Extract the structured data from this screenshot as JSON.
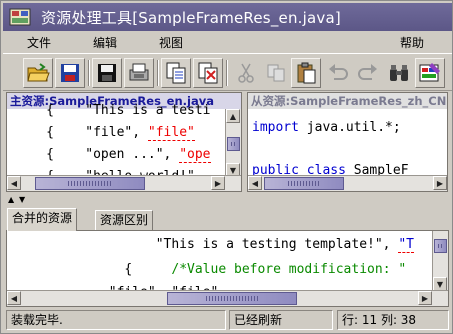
{
  "window": {
    "title": "资源处理工具[SampleFrameRes_en.java]"
  },
  "menu": {
    "file": "文件",
    "edit": "编辑",
    "view": "视图",
    "help": "帮助"
  },
  "toolbar": {
    "icons": [
      "open-folder-icon",
      "save-disk-icon",
      "save-all-icon",
      "print-icon",
      "copy-resource-icon",
      "delete-resource-icon",
      "cut-icon",
      "copy-icon",
      "paste-icon",
      "undo-icon",
      "redo-icon",
      "find-icon",
      "settings-icon"
    ]
  },
  "left_pane": {
    "header": "主资源:SampleFrameRes_en.java",
    "lines": [
      {
        "prefix": "     {    ",
        "text": "\"This is a testi",
        "link": ""
      },
      {
        "prefix": "     {    ",
        "text": "\"file\", ",
        "link": "\"file\""
      },
      {
        "prefix": "     {    ",
        "text": "\"open ...\", ",
        "link": "\"ope"
      },
      {
        "prefix": "     {    ",
        "text": "\"hello world!\"",
        "link": ""
      }
    ]
  },
  "right_pane": {
    "header": "从资源:SampleFrameRes_zh_CN.java",
    "line1_kw": "import",
    "line1_rest": " java.util.*;",
    "line2_kw": "public class",
    "line2_rest": " SampleF"
  },
  "tabs": [
    {
      "label": "合并的资源"
    },
    {
      "label": "资源区别"
    }
  ],
  "bottom_pane": {
    "line1": "                   \"This is a testing template!\",",
    "line1_link": "\"T",
    "line2_indent": "               {     ",
    "line2_comment": "/*Value before modification: \"",
    "line3": "             \"file\", \"file\"  , "
  },
  "status": {
    "left": "装载完毕.",
    "middle": "已经刷新",
    "right": "行: 11 列: 38"
  }
}
